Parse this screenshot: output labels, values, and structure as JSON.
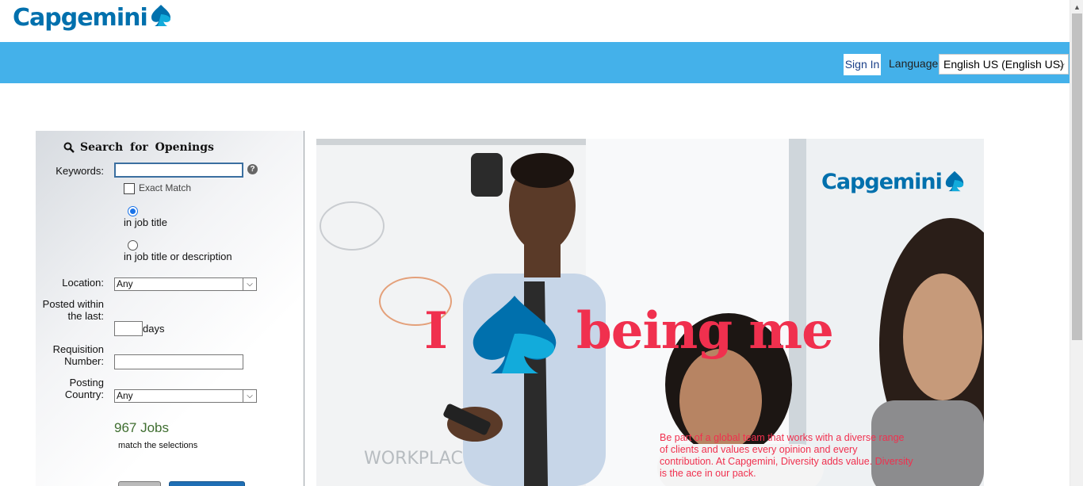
{
  "brand": {
    "name": "Capgemini",
    "color": "#0070ad",
    "accent": "#44b1ea"
  },
  "header": {
    "sign_in": "Sign In",
    "language_label": "Language",
    "language_value": "English US (English US)"
  },
  "search": {
    "title": "Search  for  Openings",
    "keywords_label": "Keywords:",
    "keywords_value": "",
    "exact_match_label": "Exact Match",
    "exact_match_checked": false,
    "radio_job_title": "in job title",
    "radio_job_title_desc": "in job title or description",
    "radio_selected": "in job title",
    "location_label": "Location:",
    "location_value": "Any",
    "posted_label": "Posted within the last:",
    "posted_value": "",
    "days_label": "days",
    "requisition_label": "Requisition Number:",
    "requisition_value": "",
    "posting_country_label": "Posting Country:",
    "posting_country_value": "Any",
    "jobs_count": "967 Jobs",
    "match_text": "match the selections"
  },
  "banner": {
    "logo_text": "Capgemini",
    "slogan_i": "I",
    "slogan_rest": "being me",
    "slogan_color": "#f0304e",
    "blurb": "Be part of a global team that works with a diverse range of clients and values every opinion and every contribution.  At Capgemini, Diversity adds value. Diversity is the ace in our pack."
  },
  "icons": [
    "spade-logo-icon",
    "search-icon",
    "help-icon",
    "chevron-down-icon"
  ]
}
